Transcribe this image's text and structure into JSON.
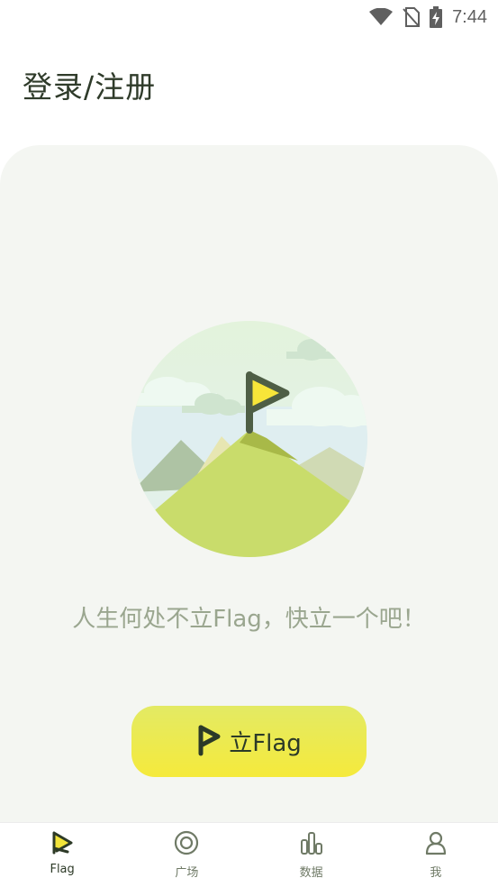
{
  "status_bar": {
    "time": "7:44",
    "icons": [
      "wifi-icon",
      "no-sim-icon",
      "battery-charging-icon"
    ]
  },
  "header": {
    "title": "登录/注册"
  },
  "main": {
    "illustration": "mountain-flag-illustration",
    "slogan": "人生何处不立Flag，快立一个吧！",
    "create_button_label": "立Flag",
    "create_button_icon": "flag-icon"
  },
  "tab_bar": {
    "tabs": [
      {
        "label": "Flag",
        "icon": "flag-tab-icon",
        "active": true
      },
      {
        "label": "广场",
        "icon": "target-icon",
        "active": false
      },
      {
        "label": "数据",
        "icon": "bar-chart-icon",
        "active": false
      },
      {
        "label": "我",
        "icon": "person-icon",
        "active": false
      }
    ]
  },
  "colors": {
    "accent_yellow": "#f5ea3c",
    "dark_green": "#2f3b2a",
    "card_bg": "#f4f6f2"
  }
}
